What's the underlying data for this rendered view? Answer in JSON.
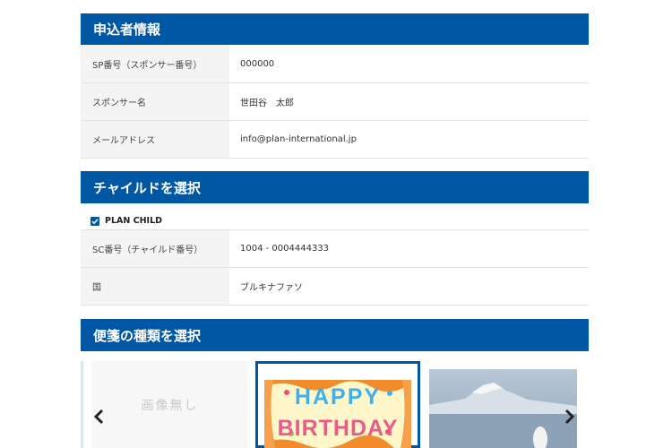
{
  "applicant": {
    "title": "申込者情報",
    "rows": [
      {
        "label": "SP番号（スポンサー番号）",
        "value": "000000"
      },
      {
        "label": "スポンサー名",
        "value": "世田谷　太郎"
      },
      {
        "label": "メールアドレス",
        "value": "info@plan-international.jp"
      }
    ]
  },
  "child": {
    "title": "チャイルドを選択",
    "checkbox_label": "PLAN CHILD",
    "checked": true,
    "rows": [
      {
        "label": "SC番号（チャイルド番号）",
        "value": "1004 - 0004444333"
      },
      {
        "label": "国",
        "value": "ブルキナファソ"
      }
    ]
  },
  "stationery": {
    "title": "便箋の種類を選択",
    "no_image_text": "画像無し",
    "birthday_word1": "HAPPY",
    "birthday_word2": "BIRTHDAY",
    "prev_icon": "chevron-left-icon",
    "next_icon": "chevron-right-icon"
  },
  "colors": {
    "header_bg": "#0057a3",
    "row_label_bg": "#f4f4f4"
  }
}
